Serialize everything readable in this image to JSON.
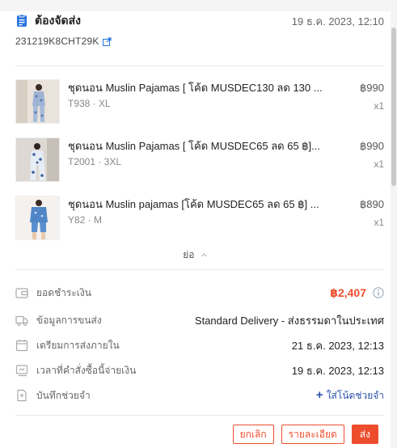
{
  "order": {
    "status": "ต้องจัดส่ง",
    "date": "19 ธ.ค. 2023, 12:10",
    "sn": "231219K8CHT29K"
  },
  "products": [
    {
      "name": "ชุดนอน Muslin Pajamas [ โค้ด MUSDEC130 ลด 130 ...",
      "variation": "T938 · XL",
      "price": "฿990",
      "qty": "x1"
    },
    {
      "name": "ชุดนอน Muslin Pajamas [ โค้ด MUSDEC65 ลด 65 ฿]...",
      "variation": "T2001 · 3XL",
      "price": "฿990",
      "qty": "x1"
    },
    {
      "name": "ชุดนอน Muslin pajamas [โค้ด MUSDEC65 ลด 65 ฿] ...",
      "variation": "Y82 · M",
      "price": "฿890",
      "qty": "x1"
    }
  ],
  "collapse_label": "ย่อ",
  "details": {
    "total_label": "ยอดชำระเงิน",
    "total_value": "฿2,407",
    "shipping_label": "ข้อมูลการขนส่ง",
    "shipping_value": "Standard Delivery - ส่งธรรมดาในประเทศ",
    "ship_by_label": "เตรียมการส่งภายใน",
    "ship_by_value": "21 ธ.ค. 2023, 12:13",
    "paid_label": "เวลาที่คำสั่งซื้อนี้จ่ายเงิน",
    "paid_value": "19 ธ.ค. 2023, 12:13",
    "note_label": "บันทึกช่วยจำ",
    "note_action": "ใส่โน้ตช่วยจำ"
  },
  "actions": {
    "cancel": "ยกเลิก",
    "details": "รายละเอียด",
    "ship": "ส่ง"
  },
  "colors": {
    "accent": "#ee4d2d",
    "link": "#2a50a8",
    "icon_blue": "#2673dd"
  },
  "icons": [
    "document-icon",
    "copy-link-icon",
    "chevron-up-icon",
    "wallet-icon",
    "truck-icon",
    "calendar-icon",
    "clock-icon",
    "note-icon",
    "help-icon"
  ]
}
